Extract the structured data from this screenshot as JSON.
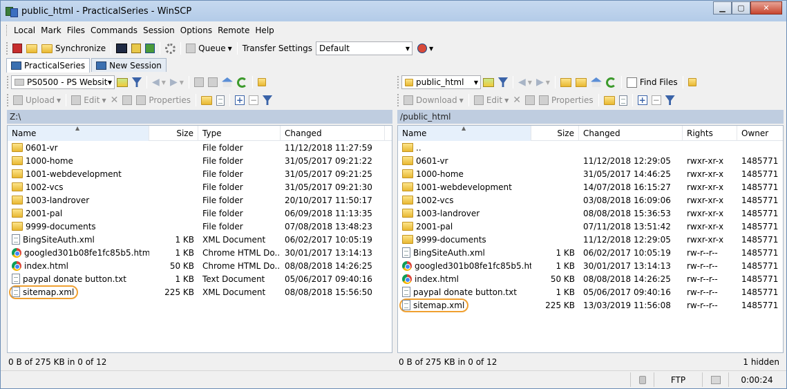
{
  "window": {
    "title": "public_html - PracticalSeries - WinSCP"
  },
  "menu": [
    "Local",
    "Mark",
    "Files",
    "Commands",
    "Session",
    "Options",
    "Remote",
    "Help"
  ],
  "toolbar": {
    "synchronize": "Synchronize",
    "queue": "Queue",
    "transfer_label": "Transfer Settings",
    "transfer_value": "Default"
  },
  "tabs": [
    {
      "label": "PracticalSeries"
    },
    {
      "label": "New Session"
    }
  ],
  "left": {
    "drive": "PS0500 - PS Websit",
    "upload": "Upload",
    "edit": "Edit",
    "properties": "Properties",
    "path": "Z:\\",
    "columns": {
      "name": "Name",
      "size": "Size",
      "type": "Type",
      "changed": "Changed"
    },
    "files": [
      {
        "name": "0601-vr",
        "size": "",
        "type": "File folder",
        "changed": "11/12/2018  11:27:59",
        "icon": "folder-icon"
      },
      {
        "name": "1000-home",
        "size": "",
        "type": "File folder",
        "changed": "31/05/2017  09:21:22",
        "icon": "folder-icon"
      },
      {
        "name": "1001-webdevelopment",
        "size": "",
        "type": "File folder",
        "changed": "31/05/2017  09:21:25",
        "icon": "folder-icon"
      },
      {
        "name": "1002-vcs",
        "size": "",
        "type": "File folder",
        "changed": "31/05/2017  09:21:30",
        "icon": "folder-icon"
      },
      {
        "name": "1003-landrover",
        "size": "",
        "type": "File folder",
        "changed": "20/10/2017  11:50:17",
        "icon": "folder-icon"
      },
      {
        "name": "2001-pal",
        "size": "",
        "type": "File folder",
        "changed": "06/09/2018  11:13:35",
        "icon": "folder-icon"
      },
      {
        "name": "9999-documents",
        "size": "",
        "type": "File folder",
        "changed": "07/08/2018  13:48:23",
        "icon": "folder-icon"
      },
      {
        "name": "BingSiteAuth.xml",
        "size": "1 KB",
        "type": "XML Document",
        "changed": "06/02/2017  10:05:19",
        "icon": "xml-file-icon"
      },
      {
        "name": "googled301b08fe1fc85b5.html",
        "size": "1 KB",
        "type": "Chrome HTML Do...",
        "changed": "30/01/2017  13:14:13",
        "icon": "chrome-icon"
      },
      {
        "name": "index.html",
        "size": "50 KB",
        "type": "Chrome HTML Do...",
        "changed": "08/08/2018  14:26:25",
        "icon": "chrome-icon"
      },
      {
        "name": "paypal donate button.txt",
        "size": "1 KB",
        "type": "Text Document",
        "changed": "05/06/2017  09:40:16",
        "icon": "text-file-icon"
      },
      {
        "name": "sitemap.xml",
        "size": "225 KB",
        "type": "XML Document",
        "changed": "08/08/2018  15:56:50",
        "icon": "xml-file-icon",
        "highlight": true
      }
    ],
    "status": "0 B of 275 KB in 0 of 12"
  },
  "right": {
    "folder": "public_html",
    "find_files": "Find Files",
    "download": "Download",
    "edit": "Edit",
    "properties": "Properties",
    "path": "/public_html",
    "columns": {
      "name": "Name",
      "size": "Size",
      "changed": "Changed",
      "rights": "Rights",
      "owner": "Owner"
    },
    "files": [
      {
        "name": "..",
        "size": "",
        "changed": "",
        "rights": "",
        "owner": "",
        "icon": "parent-dir-icon"
      },
      {
        "name": "0601-vr",
        "size": "",
        "changed": "11/12/2018 12:29:05",
        "rights": "rwxr-xr-x",
        "owner": "1485771",
        "icon": "folder-icon"
      },
      {
        "name": "1000-home",
        "size": "",
        "changed": "31/05/2017 14:46:25",
        "rights": "rwxr-xr-x",
        "owner": "1485771",
        "icon": "folder-icon"
      },
      {
        "name": "1001-webdevelopment",
        "size": "",
        "changed": "14/07/2018 16:15:27",
        "rights": "rwxr-xr-x",
        "owner": "1485771",
        "icon": "folder-icon"
      },
      {
        "name": "1002-vcs",
        "size": "",
        "changed": "03/08/2018 16:09:06",
        "rights": "rwxr-xr-x",
        "owner": "1485771",
        "icon": "folder-icon"
      },
      {
        "name": "1003-landrover",
        "size": "",
        "changed": "08/08/2018 15:36:53",
        "rights": "rwxr-xr-x",
        "owner": "1485771",
        "icon": "folder-icon"
      },
      {
        "name": "2001-pal",
        "size": "",
        "changed": "07/11/2018 13:51:42",
        "rights": "rwxr-xr-x",
        "owner": "1485771",
        "icon": "folder-icon"
      },
      {
        "name": "9999-documents",
        "size": "",
        "changed": "11/12/2018 12:29:05",
        "rights": "rwxr-xr-x",
        "owner": "1485771",
        "icon": "folder-icon"
      },
      {
        "name": "BingSiteAuth.xml",
        "size": "1 KB",
        "changed": "06/02/2017 10:05:19",
        "rights": "rw-r--r--",
        "owner": "1485771",
        "icon": "xml-file-icon"
      },
      {
        "name": "googled301b08fe1fc85b5.html",
        "size": "1 KB",
        "changed": "30/01/2017 13:14:13",
        "rights": "rw-r--r--",
        "owner": "1485771",
        "icon": "chrome-icon"
      },
      {
        "name": "index.html",
        "size": "50 KB",
        "changed": "08/08/2018 14:26:25",
        "rights": "rw-r--r--",
        "owner": "1485771",
        "icon": "chrome-icon"
      },
      {
        "name": "paypal donate button.txt",
        "size": "1 KB",
        "changed": "05/06/2017 09:40:16",
        "rights": "rw-r--r--",
        "owner": "1485771",
        "icon": "text-file-icon"
      },
      {
        "name": "sitemap.xml",
        "size": "225 KB",
        "changed": "13/03/2019 11:56:08",
        "rights": "rw-r--r--",
        "owner": "1485771",
        "icon": "xml-file-icon",
        "highlight": true
      }
    ],
    "status": "0 B of 275 KB in 0 of 12",
    "hidden": "1 hidden"
  },
  "statusbar": {
    "protocol": "FTP",
    "elapsed": "0:00:24"
  },
  "colors": {
    "highlight": "#f0a030",
    "pathbar": "#bfcde0",
    "titlebar": "#b9cfea"
  }
}
